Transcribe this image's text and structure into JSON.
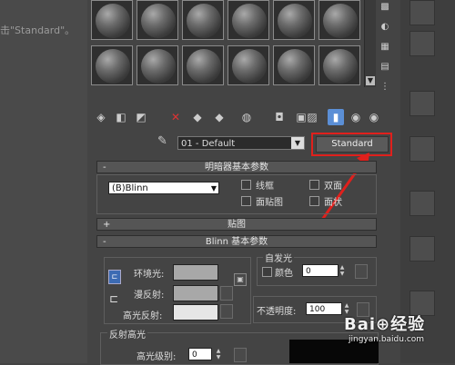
{
  "background": {
    "left_text": "击\"Standard\"。"
  },
  "material_editor": {
    "slot_count": 12,
    "toolbar_icons": [
      "get-material-icon",
      "put-to-scene-icon",
      "assign-to-selection-icon",
      "delete-icon",
      "copy-material-icon",
      "make-unique-icon",
      "put-to-library-icon",
      "material-id-icon",
      "show-map-icon",
      "show-end-result-icon",
      "go-to-parent-icon",
      "go-forward-icon"
    ],
    "material_name": "01 - Default",
    "material_type_button": "Standard",
    "highlight_color": "#e0201c"
  },
  "shader_rollout": {
    "header_sign": "-",
    "title": "明暗器基本参数",
    "shader": "(B)Blinn",
    "options": {
      "wire": "线框",
      "two_sided": "双面",
      "face_map": "面贴图",
      "faceted": "面状"
    }
  },
  "maps_rollout": {
    "header_sign": "+",
    "title": "贴图"
  },
  "blinn_rollout": {
    "header_sign": "-",
    "title": "Blinn 基本参数",
    "ambient": "环境光:",
    "diffuse": "漫反射:",
    "specular": "高光反射:",
    "self_illum_group": "自发光",
    "color_label": "颜色",
    "self_illum_value": "0",
    "opacity_label": "不透明度:",
    "opacity_value": "100",
    "spec_highlights_group": "反射高光",
    "spec_level_label": "高光级别:",
    "spec_level_value": "0",
    "ambient_color": "#a8a8a8",
    "diffuse_color": "#a8a8a8",
    "specular_color": "#e6e6e6"
  },
  "watermark": {
    "logo": "Bai⊕经验",
    "url": "jingyan.baidu.com"
  }
}
